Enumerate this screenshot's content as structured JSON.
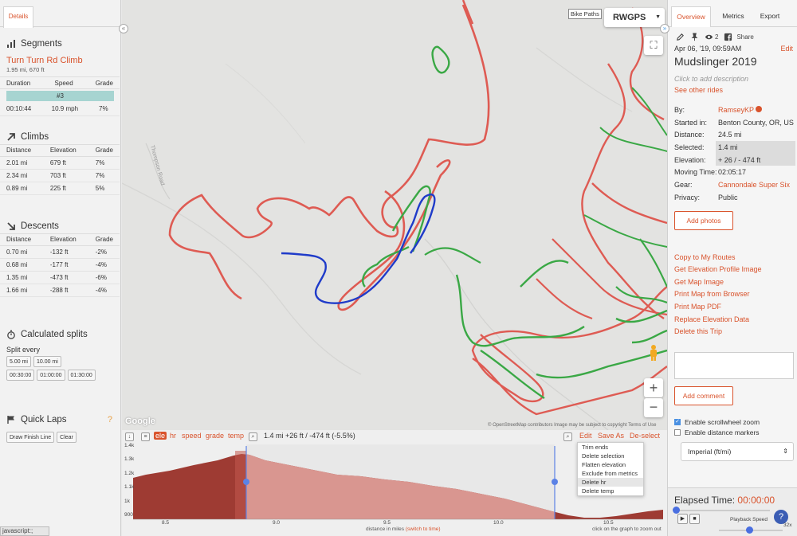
{
  "left": {
    "tab_details": "Details",
    "segments_title": "Segments",
    "segment": {
      "name": "Turn Turn Rd Climb",
      "sub": "1.95 mi, 670 ft",
      "headers": [
        "Duration",
        "Speed",
        "Grade"
      ],
      "badge": "#3",
      "values": [
        "00:10:44",
        "10.9 mph",
        "7%"
      ]
    },
    "climbs_title": "Climbs",
    "climbs": {
      "headers": [
        "Distance",
        "Elevation",
        "Grade"
      ],
      "rows": [
        [
          "2.01 mi",
          "679 ft",
          "7%"
        ],
        [
          "2.34 mi",
          "703 ft",
          "7%"
        ],
        [
          "0.89 mi",
          "225 ft",
          "5%"
        ]
      ]
    },
    "descents_title": "Descents",
    "descents": {
      "headers": [
        "Distance",
        "Elevation",
        "Grade"
      ],
      "rows": [
        [
          "0.70 mi",
          "-132 ft",
          "-2%"
        ],
        [
          "0.68 mi",
          "-177 ft",
          "-4%"
        ],
        [
          "1.35 mi",
          "-473 ft",
          "-6%"
        ],
        [
          "1.66 mi",
          "-288 ft",
          "-4%"
        ]
      ]
    },
    "splits_title": "Calculated splits",
    "split_every": "Split every",
    "split_buttons_1": [
      "5.00 mi",
      "10.00 mi"
    ],
    "split_buttons_2": [
      "00:30:00",
      "01:00:00",
      "01:30:00"
    ],
    "quick_laps_title": "Quick Laps",
    "quick_laps_help": "?",
    "draw_finish": "Draw Finish Line",
    "clear": "Clear",
    "status": "javascript:;"
  },
  "map": {
    "bike_paths": "Bike Paths",
    "layer": "RWGPS",
    "google": "Google",
    "attribution": "© OpenStreetMap contributors   Image may be subject to copyright     Terms of Use",
    "road_labels": [
      "Thompson Road",
      "Forest Road"
    ]
  },
  "elevation": {
    "tags": [
      "ele",
      "hr",
      "speed",
      "grade",
      "temp"
    ],
    "summary": "1.4 mi +26 ft / -474 ft (-5.5%)",
    "actions": [
      "Edit",
      "Save As",
      "De-select"
    ],
    "menu": [
      "Trim ends",
      "Delete selection",
      "Flatten elevation",
      "Exclude from metrics",
      "Delete hr",
      "Delete temp"
    ],
    "y_ticks": [
      "1.4k",
      "1.3k",
      "1.2k",
      "1.1k",
      "1k",
      "900"
    ],
    "x_ticks": [
      "8.5",
      "9.0",
      "9.5",
      "10.0",
      "10.5"
    ],
    "x_label": "distance in miles",
    "switch_time": "(switch to time)",
    "zoom_hint": "click on the graph to zoom out",
    "fill_color": "#d99690",
    "outside_color": "#9e3b33",
    "cursor_color": "#5b82e6"
  },
  "right": {
    "tabs": [
      "Overview",
      "Metrics",
      "Export"
    ],
    "views": "2",
    "share": "Share",
    "date": "Apr 06, '19, 09:59AM",
    "edit": "Edit",
    "title": "Mudslinger 2019",
    "add_desc": "Click to add description",
    "see_other": "See other rides",
    "info": [
      {
        "k": "By:",
        "v": "RamseyKP",
        "orange": true
      },
      {
        "k": "Started in:",
        "v": "Benton County, OR, US"
      },
      {
        "k": "Distance:",
        "v": "24.5 mi"
      },
      {
        "k": "Selected:",
        "v": "1.4 mi",
        "hl": true
      },
      {
        "k": "Elevation:",
        "v": "+ 26 / - 474 ft",
        "hl": true
      },
      {
        "k": "Moving Time:",
        "v": "02:05:17"
      },
      {
        "k": "Gear:",
        "v": "Cannondale Super Six",
        "orange": true
      },
      {
        "k": "Privacy:",
        "v": "Public"
      }
    ],
    "add_photos": "Add photos",
    "links": [
      "Copy to My Routes",
      "Get Elevation Profile Image",
      "Get Map Image",
      "Print Map from Browser",
      "Print Map PDF",
      "Replace Elevation Data",
      "Delete this Trip"
    ],
    "add_comment": "Add comment",
    "scrollwheel": "Enable scrollwheel zoom",
    "distance_markers": "Enable distance markers",
    "units": "Imperial (ft/mi)",
    "elapsed_label": "Elapsed Time:",
    "elapsed_value": "00:00:00",
    "playback_speed": "Playback Speed",
    "speed_value": "32x"
  }
}
